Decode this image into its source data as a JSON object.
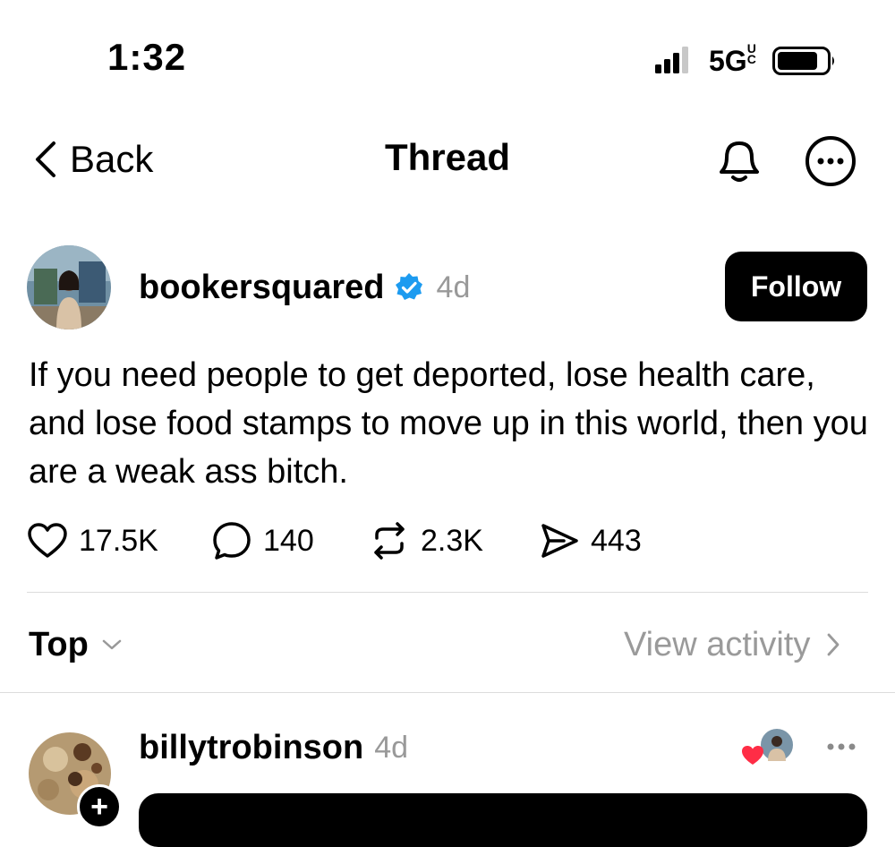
{
  "status_bar": {
    "time": "1:32",
    "network": "5GUC",
    "network_main": "5G",
    "network_sup": "UC"
  },
  "nav": {
    "back_label": "Back",
    "title": "Thread",
    "icons": [
      "chevron-left-icon",
      "bell-icon",
      "more-icon"
    ]
  },
  "post": {
    "author": "bookersquared",
    "verified": true,
    "time": "4d",
    "follow_label": "Follow",
    "text": "If you need people to get deported, lose health care, and lose food stamps to move up in this world, then you are a weak ass bitch.",
    "stats": {
      "likes": "17.5K",
      "replies": "140",
      "reposts": "2.3K",
      "shares": "443"
    }
  },
  "replies_header": {
    "sort_label": "Top",
    "view_activity_label": "View activity"
  },
  "reply": {
    "author": "billytrobinson",
    "time": "4d"
  },
  "colors": {
    "verified_blue": "#1d9bf0",
    "like_red": "#ff2d46",
    "muted_text": "#999999",
    "divider": "#dcdcdc"
  }
}
